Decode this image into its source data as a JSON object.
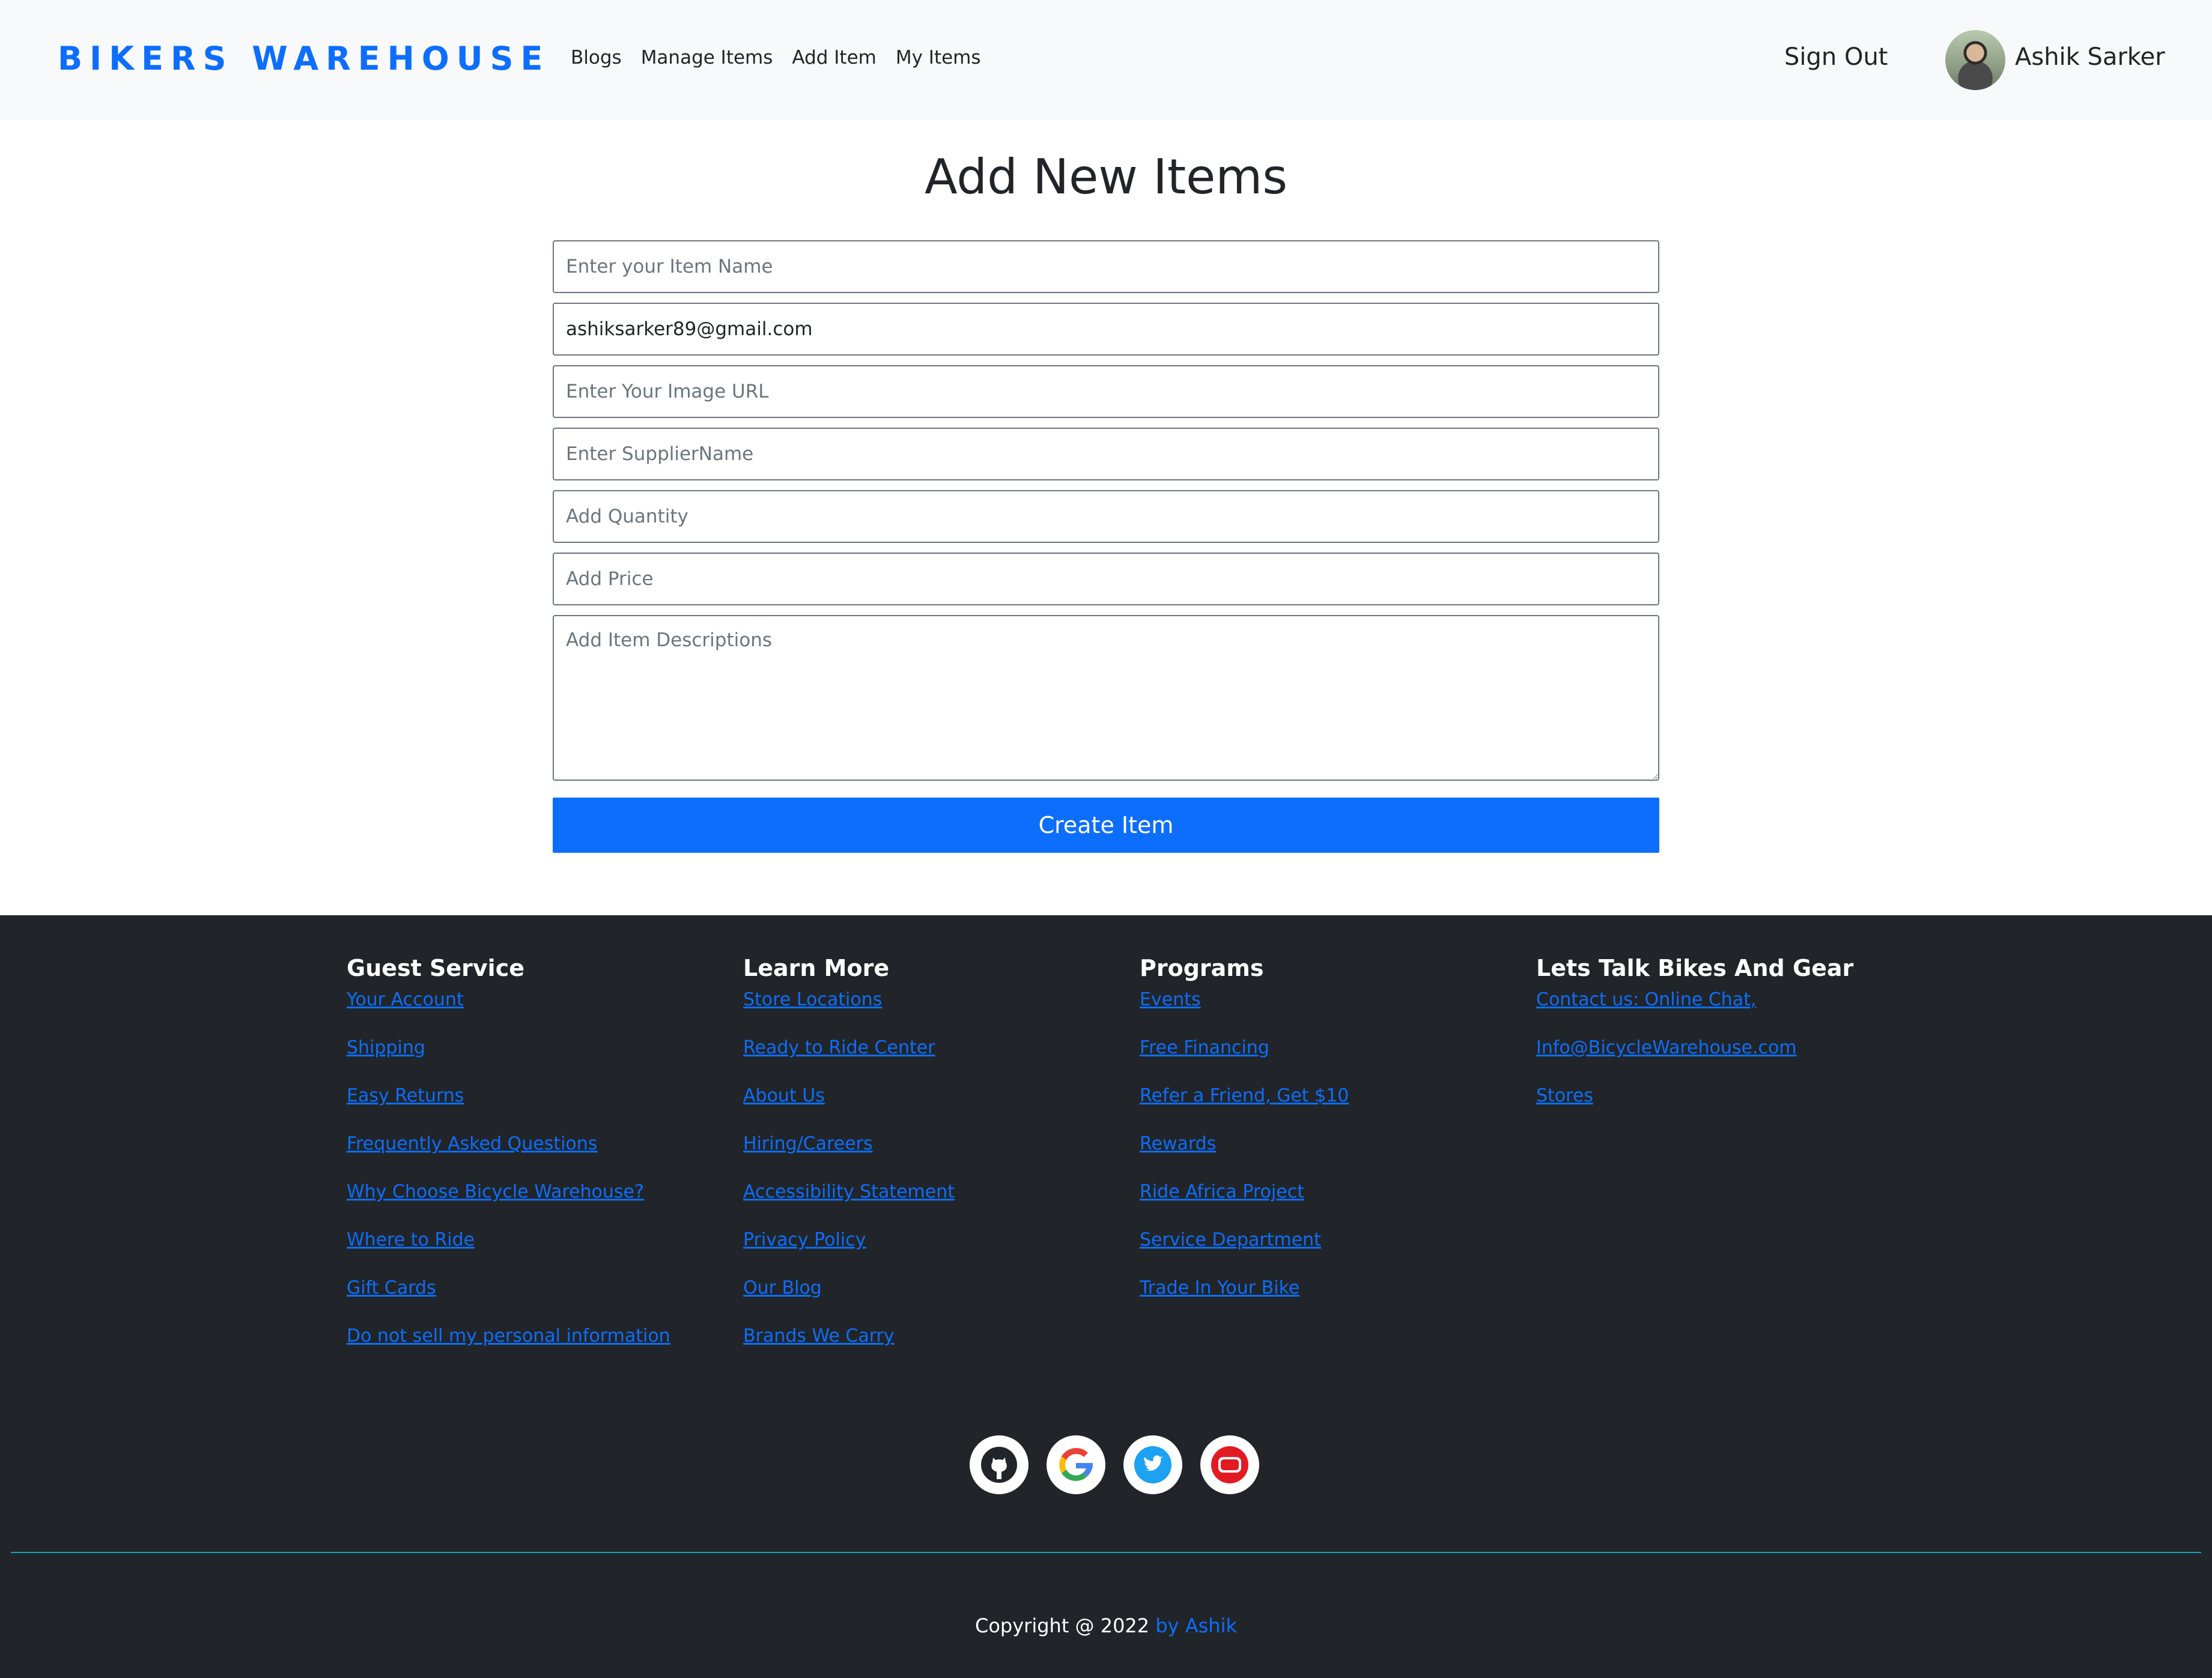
{
  "navbar": {
    "brand": "BIKERS WAREHOUSE",
    "links": [
      "Blogs",
      "Manage Items",
      "Add Item",
      "My Items"
    ],
    "sign_out": "Sign Out",
    "user_name": "Ashik Sarker"
  },
  "form": {
    "title": "Add New Items",
    "item_name_placeholder": "Enter your Item Name",
    "email_value": "ashiksarker89@gmail.com",
    "image_url_placeholder": "Enter Your Image URL",
    "supplier_placeholder": "Enter SupplierName",
    "quantity_placeholder": "Add Quantity",
    "price_placeholder": "Add Price",
    "description_placeholder": "Add Item Descriptions",
    "submit_label": "Create Item"
  },
  "footer": {
    "columns": [
      {
        "title": "Guest Service",
        "links": [
          "Your Account",
          "Shipping",
          "Easy Returns",
          "Frequently Asked Questions",
          "Why Choose Bicycle Warehouse?",
          "Where to Ride",
          "Gift Cards",
          "Do not sell my personal information"
        ]
      },
      {
        "title": "Learn More",
        "links": [
          "Store Locations",
          "Ready to Ride Center",
          "About Us",
          "Hiring/Careers",
          "Accessibility Statement",
          "Privacy Policy",
          "Our Blog",
          "Brands We Carry"
        ]
      },
      {
        "title": "Programs",
        "links": [
          "Events",
          "Free Financing",
          "Refer a Friend, Get $10",
          "Rewards",
          "Ride Africa Project",
          "Service Department",
          "Trade In Your Bike"
        ]
      },
      {
        "title": "Lets Talk Bikes And Gear",
        "links": [
          "Contact us: Online Chat,",
          "Info@BicycleWarehouse.com",
          "Stores"
        ]
      }
    ],
    "socials": [
      "github-icon",
      "google-icon",
      "twitter-icon",
      "youtube-icon"
    ],
    "copyright_text": "Copyright @ 2022 ",
    "copyright_author": "by Ashik"
  },
  "colors": {
    "accent": "#0d6efd",
    "navbar_bg": "#f8f9fa",
    "footer_bg": "#212529",
    "divider": "#17a2b8"
  }
}
